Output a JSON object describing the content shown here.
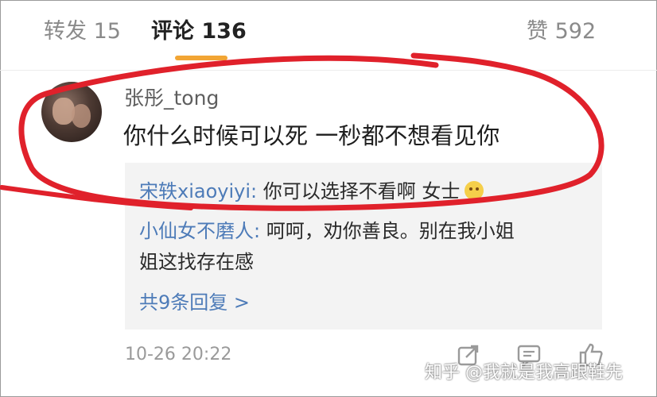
{
  "tabs": {
    "repost": "转发 15",
    "comment": "评论 136",
    "like": "赞 592"
  },
  "comment": {
    "username": "张彤_tong",
    "text": "你什么时候可以死 一秒都不想看见你",
    "avatar_icon": "avatar"
  },
  "replies": [
    {
      "user": "宋轶xiaoyiyi:",
      "text": " 你可以选择不看啊  女士",
      "emoji": "smile-emoji"
    },
    {
      "user": "小仙女不磨人:",
      "text": " 呵呵，劝你善良。别在我小姐",
      "text_continued": "姐这找存在感"
    }
  ],
  "reply_count": "共9条回复 >",
  "footer": {
    "timestamp": "10-26 20:22",
    "icons": [
      "share-icon",
      "comment-icon",
      "like-icon"
    ]
  },
  "watermark": "知乎 @我就是我高跟鞋先",
  "colors": {
    "accent_underline": "#f2a534",
    "reply_user": "#4d7bb8",
    "annotation_red": "#e0212b"
  }
}
